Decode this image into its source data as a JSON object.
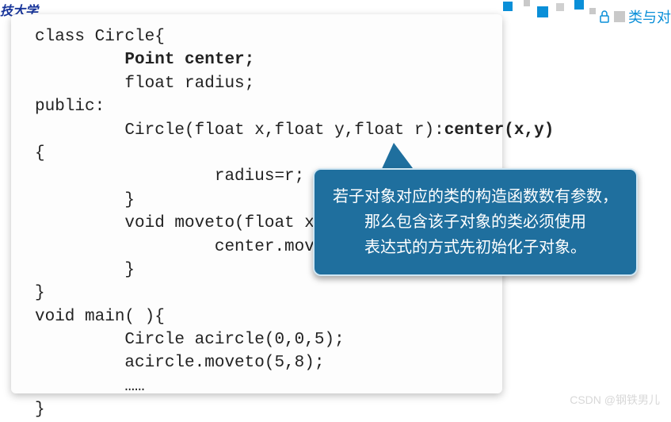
{
  "header": {
    "university_fragment": "技大学",
    "section_label": "类与对"
  },
  "code": {
    "line1": "class Circle{",
    "line2": "Point center;",
    "line3": "float radius;",
    "line4": "public:",
    "line5a": "Circle(float x,float y,float r):",
    "line5b": "center(x,y)",
    "line6": "{",
    "line7": "radius=r;",
    "line8": "}",
    "line9": "void moveto(float xx,float",
    "line10": "center.moveto(xx,y",
    "line11": "}",
    "line12": "}",
    "line13": "void main( ){",
    "line14": "Circle acircle(0,0,5);",
    "line15": "acircle.moveto(5,8);",
    "line16": "……",
    "line17": "}"
  },
  "callout": {
    "line1": "若子对象对应的类的构造函数数有参数，",
    "line2": "那么包含该子对象的类必须使用",
    "line3": "表达式的方式先初始化子对象。"
  },
  "watermark": "CSDN @钢铁男儿"
}
